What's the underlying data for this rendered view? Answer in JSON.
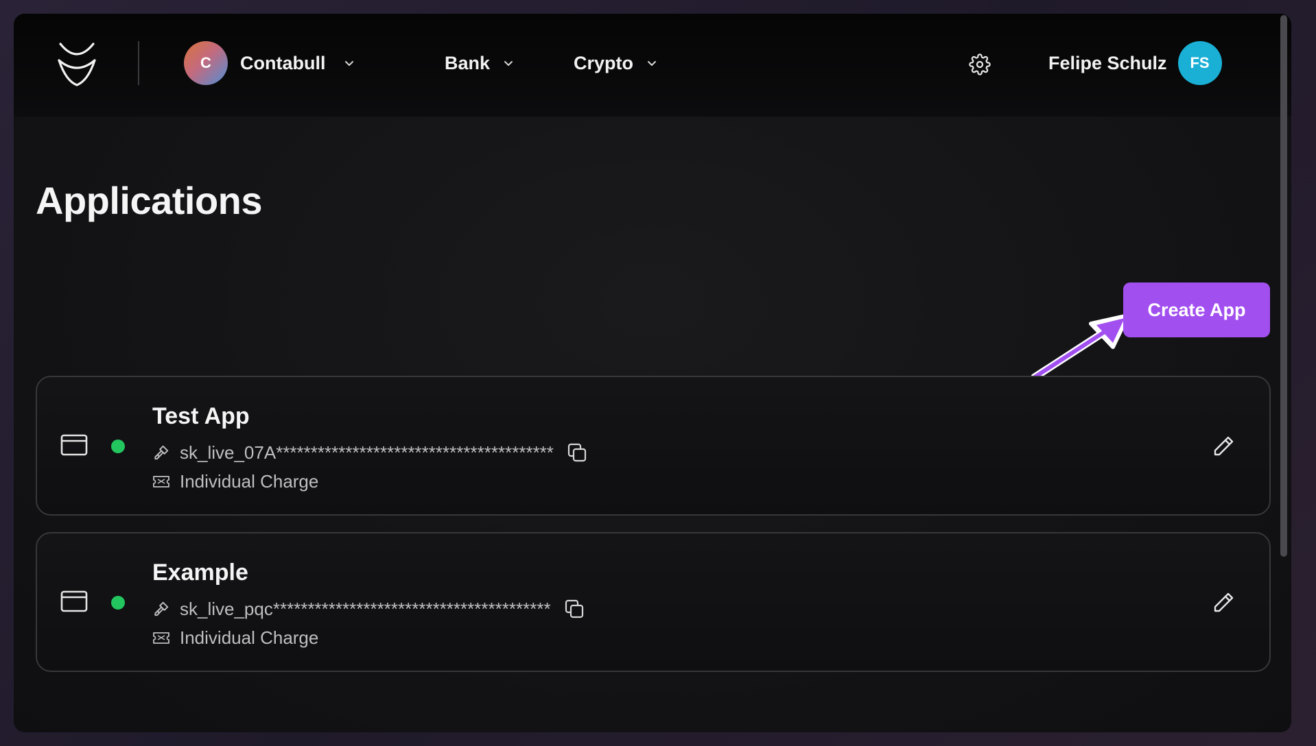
{
  "header": {
    "org": {
      "initial": "C",
      "name": "Contabull"
    },
    "nav": [
      {
        "label": "Bank"
      },
      {
        "label": "Crypto"
      }
    ],
    "user": {
      "name": "Felipe Schulz",
      "initials": "FS"
    }
  },
  "main": {
    "title": "Applications",
    "create_button": "Create App",
    "apps": [
      {
        "name": "Test App",
        "status": "active",
        "key": "sk_live_07A****************************************",
        "charge": "Individual Charge"
      },
      {
        "name": "Example",
        "status": "active",
        "key": "sk_live_pqc****************************************",
        "charge": "Individual Charge"
      }
    ]
  },
  "colors": {
    "accent": "#a24ff0",
    "status_active": "#22c55e",
    "user_avatar": "#1ab0d6"
  },
  "icons": [
    "logo-icon",
    "chevron-down-icon",
    "gear-icon",
    "app-window-icon",
    "key-icon",
    "copy-icon",
    "ticket-icon",
    "pencil-icon",
    "arrow-icon"
  ]
}
